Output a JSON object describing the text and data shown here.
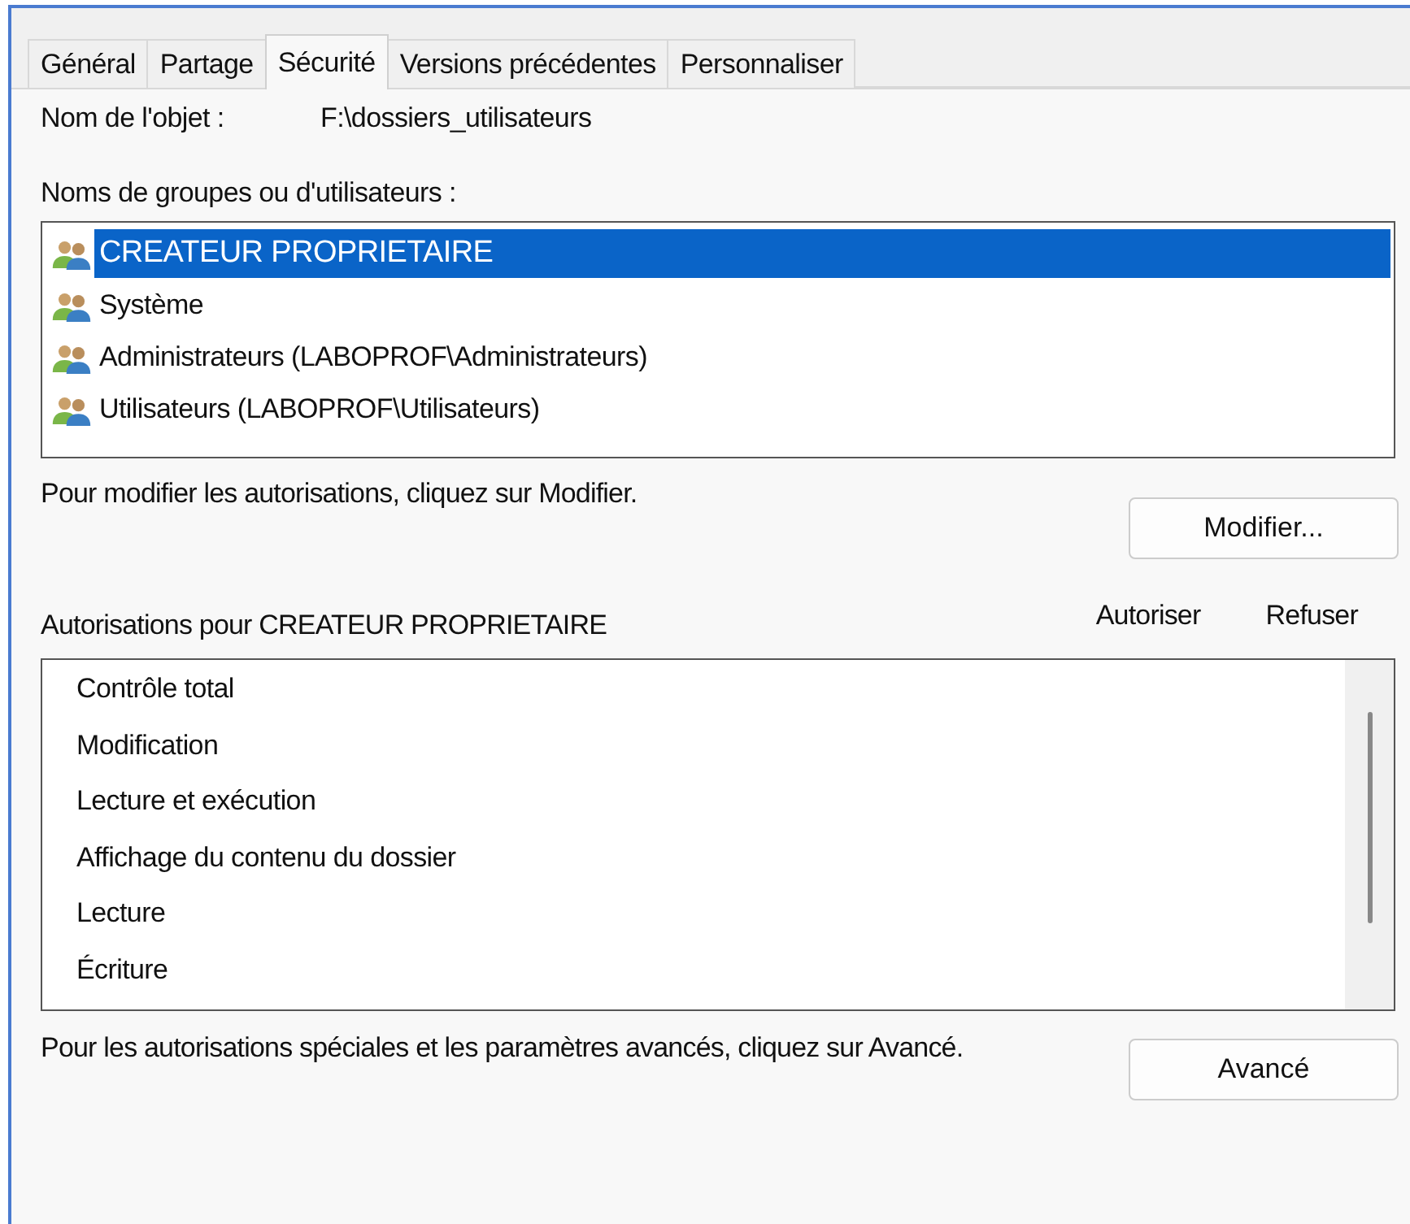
{
  "tabs": [
    {
      "label": "Général",
      "selected": false
    },
    {
      "label": "Partage",
      "selected": false
    },
    {
      "label": "Sécurité",
      "selected": true
    },
    {
      "label": "Versions précédentes",
      "selected": false
    },
    {
      "label": "Personnaliser",
      "selected": false
    }
  ],
  "object_name": {
    "label": "Nom de l'objet :",
    "value": "F:\\dossiers_utilisateurs"
  },
  "groups": {
    "label": "Noms de groupes ou d'utilisateurs :",
    "items": [
      {
        "name": "CREATEUR PROPRIETAIRE",
        "selected": true
      },
      {
        "name": "Système",
        "selected": false
      },
      {
        "name": "Administrateurs (LABOPROF\\Administrateurs)",
        "selected": false
      },
      {
        "name": "Utilisateurs (LABOPROF\\Utilisateurs)",
        "selected": false
      }
    ]
  },
  "edit_hint": "Pour modifier les autorisations, cliquez sur Modifier.",
  "edit_button": "Modifier...",
  "permissions": {
    "label": "Autorisations pour CREATEUR PROPRIETAIRE",
    "columns": [
      "Autoriser",
      "Refuser"
    ],
    "items": [
      "Contrôle total",
      "Modification",
      "Lecture et exécution",
      "Affichage du contenu du dossier",
      "Lecture",
      "Écriture"
    ]
  },
  "advanced_hint": "Pour les autorisations spéciales et les paramètres avancés, cliquez sur Avancé.",
  "advanced_button": "Avancé"
}
